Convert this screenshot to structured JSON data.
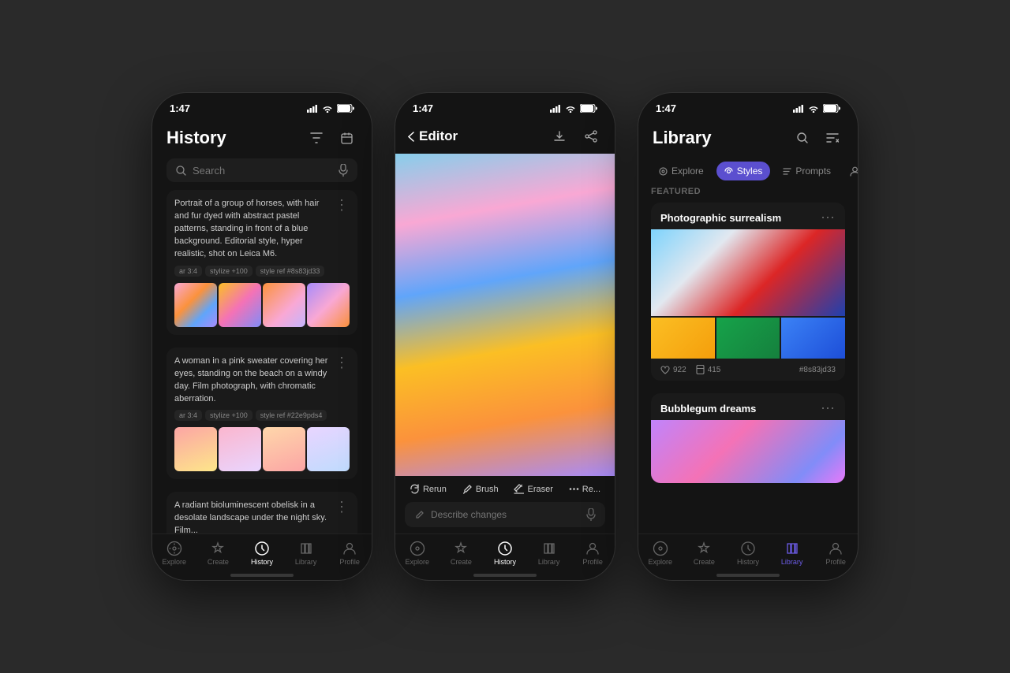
{
  "background_color": "#2a2a2a",
  "phones": [
    {
      "id": "history",
      "status_time": "1:47",
      "page_title": "History",
      "search_placeholder": "Search",
      "active_tab": "history",
      "tabs": [
        {
          "id": "explore",
          "label": "Explore",
          "icon": "compass"
        },
        {
          "id": "create",
          "label": "Create",
          "icon": "sparkle"
        },
        {
          "id": "history",
          "label": "History",
          "icon": "clock"
        },
        {
          "id": "library",
          "label": "Library",
          "icon": "book"
        },
        {
          "id": "profile",
          "label": "Profile",
          "icon": "person"
        }
      ],
      "history_items": [
        {
          "description": "Portrait of a group of horses, with hair and fur dyed with abstract pastel patterns, standing in front of a blue background.  Editorial style, hyper realistic, shot on Leica M6.",
          "tags": [
            "ar 3:4",
            "stylize +100",
            "style ref #8s83jd33"
          ],
          "thumb_colors": [
            "horse1",
            "horse2",
            "horse3",
            "horse4"
          ]
        },
        {
          "description": "A woman in a pink sweater covering her eyes, standing on the beach on a windy day. Film photograph, with chromatic aberration.",
          "tags": [
            "ar 3:4",
            "stylize +100",
            "style ref #22e9pds4"
          ],
          "thumb_colors": [
            "woman1",
            "woman2",
            "woman3",
            "woman4"
          ]
        },
        {
          "description": "A radiant bioluminescent obelisk in a desolate landscape under the night sky. Film...",
          "tags": [],
          "thumb_colors": []
        }
      ]
    },
    {
      "id": "editor",
      "status_time": "1:47",
      "page_title": "Editor",
      "active_tab": "history",
      "tabs": [
        {
          "id": "explore",
          "label": "Explore",
          "icon": "compass"
        },
        {
          "id": "create",
          "label": "Create",
          "icon": "sparkle"
        },
        {
          "id": "history",
          "label": "History",
          "icon": "clock"
        },
        {
          "id": "library",
          "label": "Library",
          "icon": "book"
        },
        {
          "id": "profile",
          "label": "Profile",
          "icon": "person"
        }
      ],
      "tools": [
        "Rerun",
        "Brush",
        "Eraser",
        "Re..."
      ],
      "describe_placeholder": "Describe changes"
    },
    {
      "id": "library",
      "status_time": "1:47",
      "page_title": "Library",
      "active_tab": "library",
      "lib_tabs": [
        {
          "id": "explore",
          "label": "Explore",
          "active": false
        },
        {
          "id": "styles",
          "label": "Styles",
          "active": true
        },
        {
          "id": "prompts",
          "label": "Prompts",
          "active": false
        },
        {
          "id": "person",
          "label": "",
          "active": false
        }
      ],
      "featured_label": "Featured",
      "tabs": [
        {
          "id": "explore",
          "label": "Explore",
          "icon": "compass"
        },
        {
          "id": "create",
          "label": "Create",
          "icon": "sparkle"
        },
        {
          "id": "history",
          "label": "History",
          "icon": "clock"
        },
        {
          "id": "library",
          "label": "Library",
          "icon": "book"
        },
        {
          "id": "profile",
          "label": "Profile",
          "icon": "person"
        }
      ],
      "style_cards": [
        {
          "title": "Photographic surrealism",
          "likes": "922",
          "saves": "415",
          "tag": "#8s83jd33"
        },
        {
          "title": "Bubblegum dreams",
          "likes": "",
          "saves": "",
          "tag": ""
        }
      ]
    }
  ],
  "lib_tabs_labels": {
    "explore": "Explore",
    "styles": "Styles",
    "prompts": "Prompts"
  }
}
